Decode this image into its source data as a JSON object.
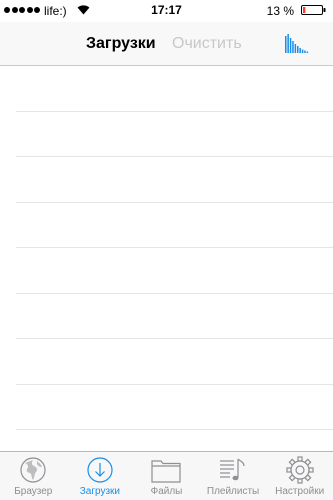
{
  "status_bar": {
    "carrier": "life:)",
    "time": "17:17",
    "battery_percent": "13 %",
    "signal_bars": 5,
    "wifi_icon": "wifi-icon",
    "battery_level": 0.13,
    "battery_color": "#ff3b30"
  },
  "nav_bar": {
    "title": "Загрузки",
    "clear_label": "Очистить",
    "visualizer_icon": "equalizer-icon",
    "accent_color": "#1a8ee6"
  },
  "list": {
    "row_count": 8
  },
  "tab_bar": {
    "tabs": [
      {
        "label": "Браузер",
        "icon": "globe-icon",
        "active": false
      },
      {
        "label": "Загрузки",
        "icon": "download-icon",
        "active": true
      },
      {
        "label": "Файлы",
        "icon": "folder-icon",
        "active": false
      },
      {
        "label": "Плейлисты",
        "icon": "playlist-icon",
        "active": false
      },
      {
        "label": "Настройки",
        "icon": "gear-icon",
        "active": false
      }
    ]
  }
}
